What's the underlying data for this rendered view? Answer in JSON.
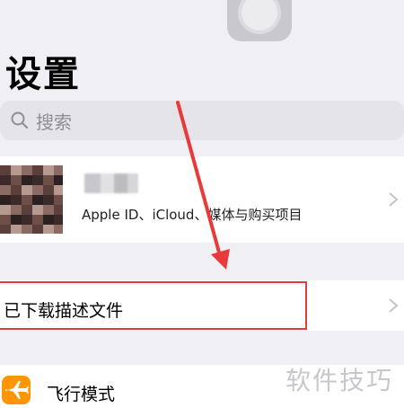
{
  "header": {
    "title": "设置"
  },
  "search": {
    "placeholder": "搜索"
  },
  "profile": {
    "subtitle": "Apple ID、iCloud、媒体与购买项目",
    "avatar_colors": [
      "#5a3f3c",
      "#3a2a2a",
      "#8a6a62",
      "#2b2121",
      "#b69a92",
      "#6e4e48"
    ]
  },
  "rows": {
    "profiles": "已下载描述文件",
    "airplane": "飞行模式"
  },
  "watermark": "软件技巧",
  "colors": {
    "highlight": "#e03c3c",
    "airplane_icon": "#ff9500",
    "background": "#efeff4"
  }
}
